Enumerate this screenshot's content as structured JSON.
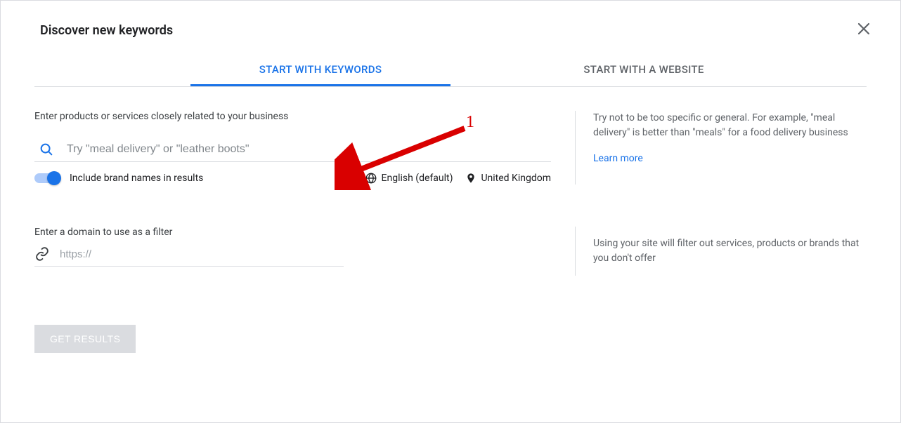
{
  "header": {
    "title": "Discover new keywords"
  },
  "tabs": {
    "keywords": "START WITH KEYWORDS",
    "website": "START WITH A WEBSITE"
  },
  "keywords_section": {
    "label": "Enter products or services closely related to your business",
    "placeholder": "Try \"meal delivery\" or \"leather boots\"",
    "include_brands_label": "Include brand names in results",
    "language": "English (default)",
    "location": "United Kingdom",
    "help_text": "Try not to be too specific or general. For example, \"meal delivery\" is better than \"meals\" for a food delivery business",
    "learn_more": "Learn more"
  },
  "domain_section": {
    "label": "Enter a domain to use as a filter",
    "placeholder": "https://",
    "help_text": "Using your site will filter out services, products or brands that you don't offer"
  },
  "cta": {
    "label": "GET RESULTS"
  },
  "annotation": {
    "number": "1"
  }
}
